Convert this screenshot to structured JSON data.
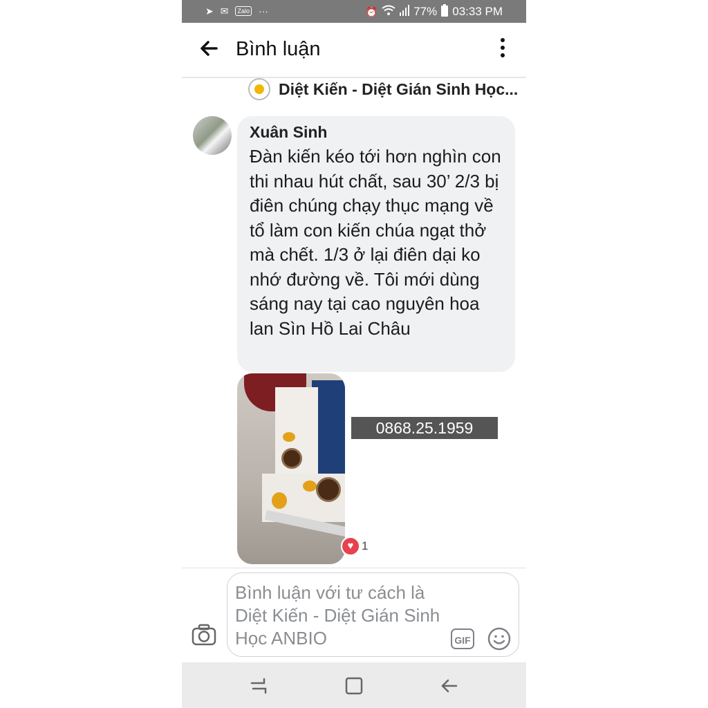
{
  "status_bar": {
    "icons_left": [
      "send-icon",
      "gmail-icon",
      "zalo-icon",
      "more-notifications-icon"
    ],
    "zalo_label": "Zalo",
    "more_dots": "···",
    "icons_right": [
      "alarm-icon",
      "wifi-icon",
      "signal-icon",
      "battery-icon"
    ],
    "battery": "77%",
    "time": "03:33 PM"
  },
  "app_bar": {
    "title": "Bình luận"
  },
  "post": {
    "page_name": "Diệt Kiến - Diệt Gián Sinh Học..."
  },
  "comment": {
    "author": "Xuân Sinh",
    "text": "Đàn kiến kéo tới hơn nghìn con thi nhau hút chất, sau 30’ 2/3 bị điên chúng chạy thục mạng về tổ làm con kiến chúa ngạt thở mà chết. 1/3 ở lại điên dại ko nhớ đường về. Tôi mới dùng sáng nay tại cao nguyên hoa lan Sìn Hồ Lai Châu",
    "reaction_icon": "heart-icon",
    "reaction_count": "1"
  },
  "overlay": {
    "phone_number": "0868.25.1959"
  },
  "composer": {
    "placeholder": "Bình luận với tư cách là Diệt Kiến - Diệt Gián Sinh Học ANBIO",
    "gif_label": "GIF"
  },
  "nav_bar": {
    "icons": [
      "recent-apps-icon",
      "home-icon",
      "back-icon"
    ]
  }
}
